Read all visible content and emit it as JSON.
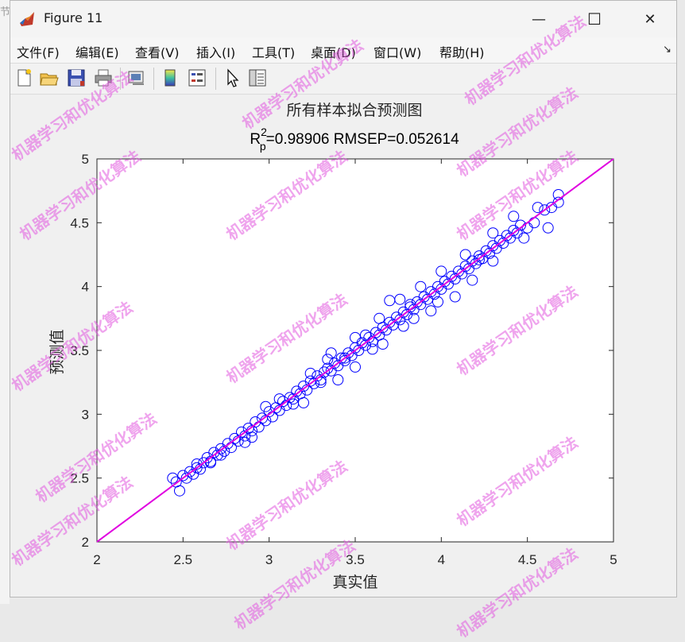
{
  "background_window": {
    "title_fragment": "节"
  },
  "window": {
    "title": "Figure 11",
    "buttons": {
      "minimize": "—",
      "maximize": "☐",
      "close": "✕"
    }
  },
  "menu": {
    "items": [
      "文件(F)",
      "编辑(E)",
      "查看(V)",
      "插入(I)",
      "工具(T)",
      "桌面(D)",
      "窗口(W)",
      "帮助(H)"
    ],
    "dock_icon": "↘"
  },
  "toolbar": {
    "icons": [
      "new-figure-icon",
      "open-file-icon",
      "save-icon",
      "print-icon",
      "link-plot-icon",
      "colorbar-icon",
      "legend-icon",
      "pointer-icon",
      "property-inspector-icon"
    ]
  },
  "watermark": {
    "text": "机器学习和优化算法"
  },
  "chart_data": {
    "type": "scatter",
    "title": "所有样本拟合预测图",
    "subtitle": {
      "main": "R",
      "sup": "2",
      "sub": "p",
      "rest": "=0.98906  RMSEP=0.052614"
    },
    "xlabel": "真实值",
    "ylabel": "预测值",
    "xlim": [
      2,
      5
    ],
    "ylim": [
      2,
      5
    ],
    "xticks": [
      "2",
      "2.5",
      "3",
      "3.5",
      "4",
      "4.5",
      "5"
    ],
    "yticks": [
      "2",
      "2.5",
      "3",
      "3.5",
      "4",
      "4.5",
      "5"
    ],
    "grid": false,
    "series": [
      {
        "marker": "circle",
        "color": "#0000ff",
        "points": [
          [
            2.44,
            2.5
          ],
          [
            2.46,
            2.47
          ],
          [
            2.48,
            2.4
          ],
          [
            2.5,
            2.52
          ],
          [
            2.52,
            2.5
          ],
          [
            2.54,
            2.55
          ],
          [
            2.56,
            2.53
          ],
          [
            2.58,
            2.58
          ],
          [
            2.6,
            2.57
          ],
          [
            2.62,
            2.62
          ],
          [
            2.64,
            2.66
          ],
          [
            2.66,
            2.63
          ],
          [
            2.68,
            2.7
          ],
          [
            2.7,
            2.68
          ],
          [
            2.72,
            2.73
          ],
          [
            2.74,
            2.71
          ],
          [
            2.76,
            2.77
          ],
          [
            2.78,
            2.74
          ],
          [
            2.8,
            2.81
          ],
          [
            2.82,
            2.79
          ],
          [
            2.84,
            2.86
          ],
          [
            2.86,
            2.83
          ],
          [
            2.88,
            2.89
          ],
          [
            2.9,
            2.87
          ],
          [
            2.92,
            2.94
          ],
          [
            2.94,
            2.9
          ],
          [
            2.96,
            2.97
          ],
          [
            2.98,
            2.95
          ],
          [
            3.0,
            3.02
          ],
          [
            3.02,
            2.98
          ],
          [
            3.04,
            3.05
          ],
          [
            3.06,
            3.03
          ],
          [
            3.08,
            3.1
          ],
          [
            3.1,
            3.07
          ],
          [
            3.12,
            3.13
          ],
          [
            3.14,
            3.12
          ],
          [
            3.16,
            3.18
          ],
          [
            3.18,
            3.16
          ],
          [
            3.2,
            3.22
          ],
          [
            3.22,
            3.19
          ],
          [
            3.24,
            3.26
          ],
          [
            3.26,
            3.24
          ],
          [
            3.28,
            3.3
          ],
          [
            3.3,
            3.27
          ],
          [
            3.32,
            3.33
          ],
          [
            3.34,
            3.36
          ],
          [
            3.36,
            3.34
          ],
          [
            3.38,
            3.4
          ],
          [
            3.4,
            3.38
          ],
          [
            3.42,
            3.44
          ],
          [
            3.44,
            3.42
          ],
          [
            3.46,
            3.48
          ],
          [
            3.48,
            3.46
          ],
          [
            3.5,
            3.52
          ],
          [
            3.52,
            3.5
          ],
          [
            3.54,
            3.56
          ],
          [
            3.56,
            3.54
          ],
          [
            3.58,
            3.6
          ],
          [
            3.6,
            3.57
          ],
          [
            3.62,
            3.64
          ],
          [
            3.64,
            3.62
          ],
          [
            3.66,
            3.68
          ],
          [
            3.68,
            3.66
          ],
          [
            3.7,
            3.72
          ],
          [
            3.72,
            3.7
          ],
          [
            3.74,
            3.76
          ],
          [
            3.76,
            3.74
          ],
          [
            3.78,
            3.8
          ],
          [
            3.8,
            3.78
          ],
          [
            3.82,
            3.84
          ],
          [
            3.84,
            3.82
          ],
          [
            3.86,
            3.88
          ],
          [
            3.88,
            3.86
          ],
          [
            3.9,
            3.92
          ],
          [
            3.92,
            3.9
          ],
          [
            3.94,
            3.96
          ],
          [
            3.96,
            3.94
          ],
          [
            3.98,
            4.0
          ],
          [
            4.0,
            3.98
          ],
          [
            4.02,
            4.04
          ],
          [
            4.04,
            4.02
          ],
          [
            4.06,
            4.08
          ],
          [
            4.08,
            4.06
          ],
          [
            4.1,
            4.12
          ],
          [
            4.12,
            4.1
          ],
          [
            4.14,
            4.16
          ],
          [
            4.16,
            4.14
          ],
          [
            4.18,
            4.2
          ],
          [
            4.2,
            4.18
          ],
          [
            4.22,
            4.24
          ],
          [
            4.24,
            4.22
          ],
          [
            4.26,
            4.28
          ],
          [
            4.28,
            4.26
          ],
          [
            4.3,
            4.32
          ],
          [
            4.32,
            4.3
          ],
          [
            4.34,
            4.36
          ],
          [
            4.36,
            4.34
          ],
          [
            4.38,
            4.4
          ],
          [
            4.4,
            4.38
          ],
          [
            4.42,
            4.44
          ],
          [
            4.44,
            4.42
          ],
          [
            4.46,
            4.48
          ],
          [
            4.5,
            4.46
          ],
          [
            4.54,
            4.5
          ],
          [
            4.6,
            4.6
          ],
          [
            4.64,
            4.62
          ],
          [
            4.68,
            4.72
          ],
          [
            4.68,
            4.66
          ],
          [
            2.9,
            2.82
          ],
          [
            3.14,
            3.08
          ],
          [
            3.3,
            3.25
          ],
          [
            3.4,
            3.27
          ],
          [
            3.5,
            3.37
          ],
          [
            3.6,
            3.51
          ],
          [
            3.66,
            3.55
          ],
          [
            3.78,
            3.69
          ],
          [
            3.84,
            3.75
          ],
          [
            3.98,
            3.88
          ],
          [
            4.08,
            3.92
          ],
          [
            4.18,
            4.05
          ],
          [
            4.3,
            4.2
          ],
          [
            4.48,
            4.38
          ],
          [
            4.62,
            4.46
          ],
          [
            2.98,
            3.06
          ],
          [
            3.24,
            3.32
          ],
          [
            3.34,
            3.43
          ],
          [
            3.5,
            3.6
          ],
          [
            3.64,
            3.75
          ],
          [
            3.7,
            3.89
          ],
          [
            3.76,
            3.9
          ],
          [
            3.88,
            4.0
          ],
          [
            4.0,
            4.12
          ],
          [
            4.14,
            4.25
          ],
          [
            4.3,
            4.42
          ],
          [
            4.42,
            4.55
          ],
          [
            4.56,
            4.62
          ],
          [
            4.22,
            4.21
          ],
          [
            3.94,
            3.81
          ],
          [
            3.2,
            3.09
          ],
          [
            2.86,
            2.78
          ],
          [
            2.66,
            2.62
          ],
          [
            3.36,
            3.48
          ],
          [
            3.44,
            3.44
          ],
          [
            2.58,
            2.61
          ],
          [
            2.72,
            2.68
          ],
          [
            3.06,
            3.12
          ],
          [
            3.56,
            3.62
          ],
          [
            3.82,
            3.86
          ]
        ]
      }
    ],
    "fit_line": {
      "from": [
        2,
        2
      ],
      "to": [
        5,
        5
      ],
      "color": "#e000e0"
    }
  }
}
